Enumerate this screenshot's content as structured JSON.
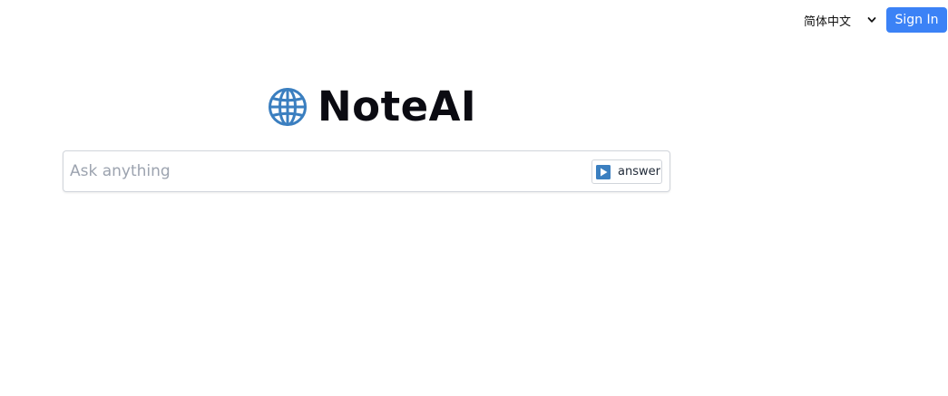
{
  "header": {
    "language": {
      "selected": "简体中文",
      "icon": "chevron-down-icon"
    },
    "signin_label": "Sign In"
  },
  "logo": {
    "icon": "globe-icon",
    "text": "NoteAI"
  },
  "search": {
    "placeholder": "Ask anything",
    "value": "",
    "answer_label": "answer",
    "answer_icon": "play-icon"
  },
  "colors": {
    "accent": "#3b82f6",
    "globe": "#3b7fc0",
    "play": "#3b7fc0"
  }
}
